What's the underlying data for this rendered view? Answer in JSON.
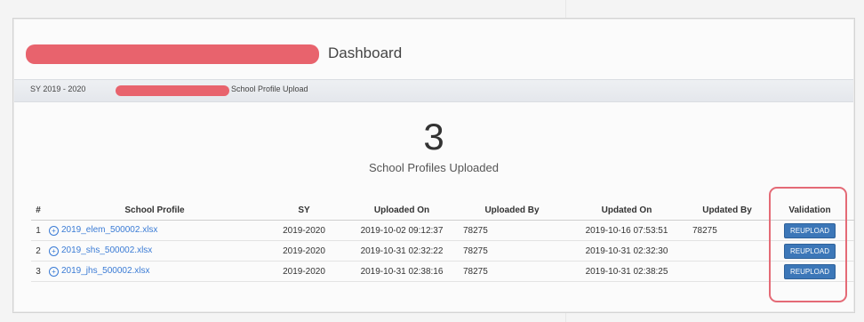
{
  "header": {
    "title": "Dashboard"
  },
  "subheader": {
    "sy_label": "SY 2019 - 2020",
    "page_label": "School Profile Upload"
  },
  "stats": {
    "count": "3",
    "label": "School Profiles Uploaded"
  },
  "table": {
    "headers": [
      "#",
      "School Profile",
      "SY",
      "Uploaded On",
      "Uploaded By",
      "Updated On",
      "Updated By",
      "Validation"
    ],
    "rows": [
      {
        "num": "1",
        "file": "2019_elem_500002.xlsx",
        "sy": "2019-2020",
        "uploaded_on": "2019-10-02 09:12:37",
        "uploaded_by": "78275",
        "updated_on": "2019-10-16 07:53:51",
        "updated_by": "78275",
        "action": "REUPLOAD"
      },
      {
        "num": "2",
        "file": "2019_shs_500002.xlsx",
        "sy": "2019-2020",
        "uploaded_on": "2019-10-31 02:32:22",
        "uploaded_by": "78275",
        "updated_on": "2019-10-31 02:32:30",
        "updated_by": "",
        "action": "REUPLOAD"
      },
      {
        "num": "3",
        "file": "2019_jhs_500002.xlsx",
        "sy": "2019-2020",
        "uploaded_on": "2019-10-31 02:38:16",
        "uploaded_by": "78275",
        "updated_on": "2019-10-31 02:38:25",
        "updated_by": "",
        "action": "REUPLOAD"
      }
    ]
  },
  "colors": {
    "redaction": "#e8636d",
    "button": "#3c77b8",
    "link": "#3a7bd5",
    "highlight": "#e46a76"
  },
  "icons": {
    "file_link": "plus-circle-icon"
  }
}
